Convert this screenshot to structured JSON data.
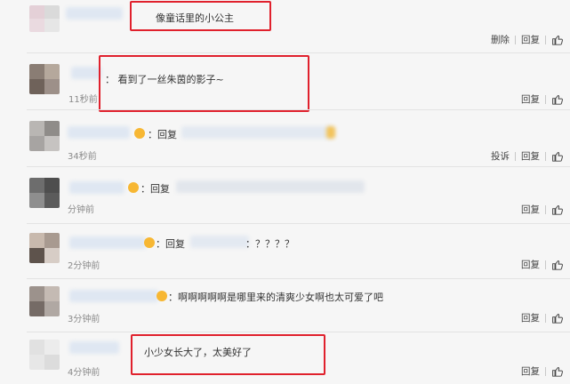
{
  "colors": {
    "highlight": "#e0212d",
    "link_blue": "#5b8fd6",
    "text": "#333333",
    "muted": "#8a8a8a"
  },
  "icons": {
    "like": "thumbs-up-icon",
    "emoji": "smiley-face-icon"
  },
  "comments": [
    {
      "text": "像童话里的小公主",
      "time": "",
      "actions": [
        "删除",
        "回复"
      ]
    },
    {
      "text": "：  看到了一丝朱茵的影子~",
      "time": "11秒前",
      "actions": [
        "回复"
      ]
    },
    {
      "text": "：回复",
      "time": "34秒前",
      "actions": [
        "投诉",
        "回复"
      ]
    },
    {
      "text": "：回复",
      "time": "分钟前",
      "actions": [
        "回复"
      ]
    },
    {
      "text": "：回复",
      "text2": "：？？？？",
      "time": "2分钟前",
      "actions": [
        "回复"
      ]
    },
    {
      "text": "：啊啊啊啊啊是哪里来的清爽少女啊也太可爱了吧",
      "time": "3分钟前",
      "actions": [
        "回复"
      ]
    },
    {
      "text": "小少女长大了，太美好了",
      "time": "4分钟前",
      "actions": [
        "回复"
      ]
    }
  ]
}
